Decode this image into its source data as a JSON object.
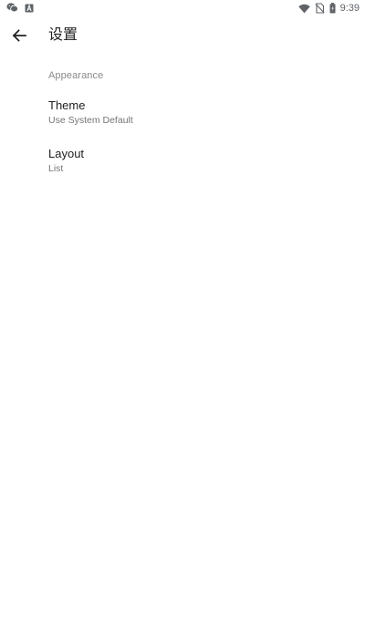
{
  "status_bar": {
    "time": "9:39",
    "left_icons": [
      "wechat-icon",
      "a-notification-icon"
    ],
    "right_icons": [
      "wifi-icon",
      "no-sim-icon",
      "battery-icon"
    ]
  },
  "toolbar": {
    "back_icon": "arrow-back-icon",
    "title": "设置"
  },
  "preferences": {
    "section_header": "Appearance",
    "items": [
      {
        "title": "Theme",
        "summary": "Use System Default"
      },
      {
        "title": "Layout",
        "summary": "List"
      }
    ]
  },
  "colors": {
    "background": "#ffffff",
    "primary_text": "#212121",
    "secondary_text": "#757575",
    "section_header": "#8a8a8a"
  }
}
